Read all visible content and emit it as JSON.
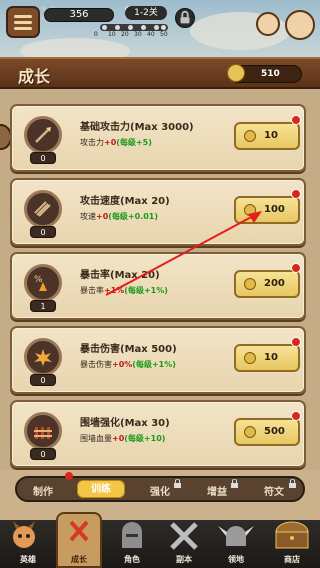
{
  "hud": {
    "power": "356",
    "stage": "1-2关",
    "progress_marks": [
      "0",
      "10",
      "20",
      "30",
      "40",
      "50"
    ]
  },
  "header": {
    "title": "成长",
    "coins": "510"
  },
  "cards": [
    {
      "name": "基础攻击力(Max 3000)",
      "stat": "攻击力",
      "plus": "+0",
      "per": "(每级+5)",
      "level": "0",
      "cost": "10"
    },
    {
      "name": "攻击速度(Max 20)",
      "stat": "攻速",
      "plus": "+0",
      "per": "(每级+0.01)",
      "level": "0",
      "cost": "100"
    },
    {
      "name": "暴击率(Max 20)",
      "stat": "暴击率",
      "plus": "+1%",
      "per": "(每级+1%)",
      "level": "1",
      "cost": "200"
    },
    {
      "name": "暴击伤害(Max 500)",
      "stat": "暴击伤害",
      "plus": "+0%",
      "per": "(每级+1%)",
      "level": "0",
      "cost": "10"
    },
    {
      "name": "围墙强化(Max 30)",
      "stat": "围墙血量",
      "plus": "+0",
      "per": "(每级+10)",
      "level": "0",
      "cost": "500"
    }
  ],
  "subtabs": [
    "制作",
    "训练",
    "强化",
    "增益",
    "符文"
  ],
  "nav": [
    "英雄",
    "成长",
    "角色",
    "副本",
    "领地",
    "商店"
  ],
  "colors": {
    "accent_gold": "#f4c646",
    "header_brown": "#6b3d1f",
    "red_dot": "#d6271a",
    "arrow_red": "#e41e1e"
  }
}
